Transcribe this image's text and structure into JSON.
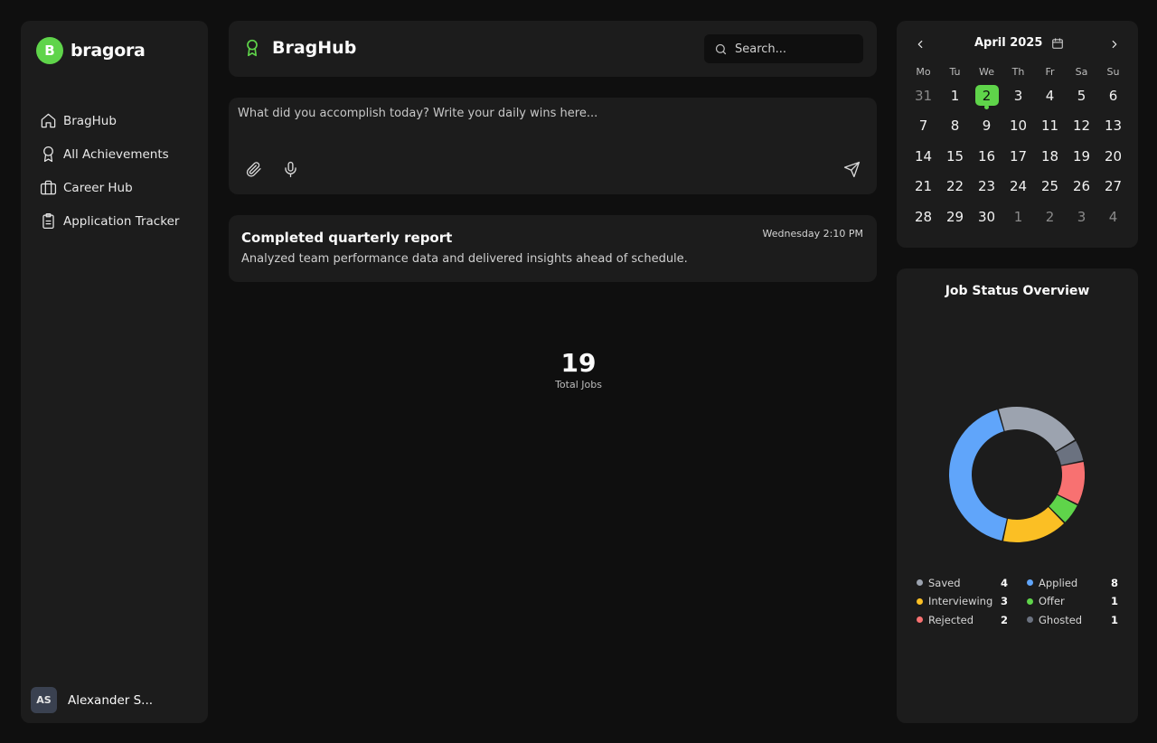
{
  "brand": {
    "logo_letter": "B",
    "name": "bragora",
    "accent": "#5fd44a"
  },
  "sidebar": {
    "items": [
      {
        "label": "BragHub",
        "icon": "home-icon"
      },
      {
        "label": "All Achievements",
        "icon": "award-icon"
      },
      {
        "label": "Career Hub",
        "icon": "briefcase-icon"
      },
      {
        "label": "Application Tracker",
        "icon": "clipboard-icon"
      }
    ],
    "user": {
      "initials": "AS",
      "name": "Alexander S..."
    }
  },
  "header": {
    "title": "BragHub",
    "search_placeholder": "Search..."
  },
  "composer": {
    "placeholder": "What did you accomplish today? Write your daily wins here..."
  },
  "achievements": [
    {
      "title": "Completed quarterly report",
      "description": "Analyzed team performance data and delivered insights ahead of schedule.",
      "time": "Wednesday 2:10 PM"
    }
  ],
  "total_jobs": {
    "value": "19",
    "label": "Total Jobs"
  },
  "calendar": {
    "month_label": "April 2025",
    "weekdays": [
      "Mo",
      "Tu",
      "We",
      "Th",
      "Fr",
      "Sa",
      "Su"
    ],
    "days": [
      {
        "d": "31",
        "muted": true
      },
      {
        "d": "1"
      },
      {
        "d": "2",
        "today": true
      },
      {
        "d": "3"
      },
      {
        "d": "4"
      },
      {
        "d": "5"
      },
      {
        "d": "6"
      },
      {
        "d": "7"
      },
      {
        "d": "8"
      },
      {
        "d": "9"
      },
      {
        "d": "10"
      },
      {
        "d": "11"
      },
      {
        "d": "12"
      },
      {
        "d": "13"
      },
      {
        "d": "14"
      },
      {
        "d": "15"
      },
      {
        "d": "16"
      },
      {
        "d": "17"
      },
      {
        "d": "18"
      },
      {
        "d": "19"
      },
      {
        "d": "20"
      },
      {
        "d": "21"
      },
      {
        "d": "22"
      },
      {
        "d": "23"
      },
      {
        "d": "24"
      },
      {
        "d": "25"
      },
      {
        "d": "26"
      },
      {
        "d": "27"
      },
      {
        "d": "28"
      },
      {
        "d": "29"
      },
      {
        "d": "30"
      },
      {
        "d": "1",
        "muted": true
      },
      {
        "d": "2",
        "muted": true
      },
      {
        "d": "3",
        "muted": true
      },
      {
        "d": "4",
        "muted": true
      }
    ]
  },
  "job_status": {
    "title": "Job Status Overview",
    "legend": [
      {
        "name": "Saved",
        "value": 4,
        "color": "#9ca3af"
      },
      {
        "name": "Applied",
        "value": 8,
        "color": "#60a5fa"
      },
      {
        "name": "Interviewing",
        "value": 3,
        "color": "#fbbf24"
      },
      {
        "name": "Offer",
        "value": 1,
        "color": "#5fd44a"
      },
      {
        "name": "Rejected",
        "value": 2,
        "color": "#f87171"
      },
      {
        "name": "Ghosted",
        "value": 1,
        "color": "#6b7280"
      }
    ]
  },
  "chart_data": {
    "type": "pie",
    "variant": "donut",
    "categories": [
      "Saved",
      "Ghosted",
      "Rejected",
      "Offer",
      "Interviewing",
      "Applied"
    ],
    "values": [
      4,
      1,
      2,
      1,
      3,
      8
    ],
    "colors": [
      "#9ca3af",
      "#6b7280",
      "#f87171",
      "#5fd44a",
      "#fbbf24",
      "#60a5fa"
    ],
    "title": "Job Status Overview",
    "center_value": 19,
    "center_label": "Total Jobs"
  }
}
